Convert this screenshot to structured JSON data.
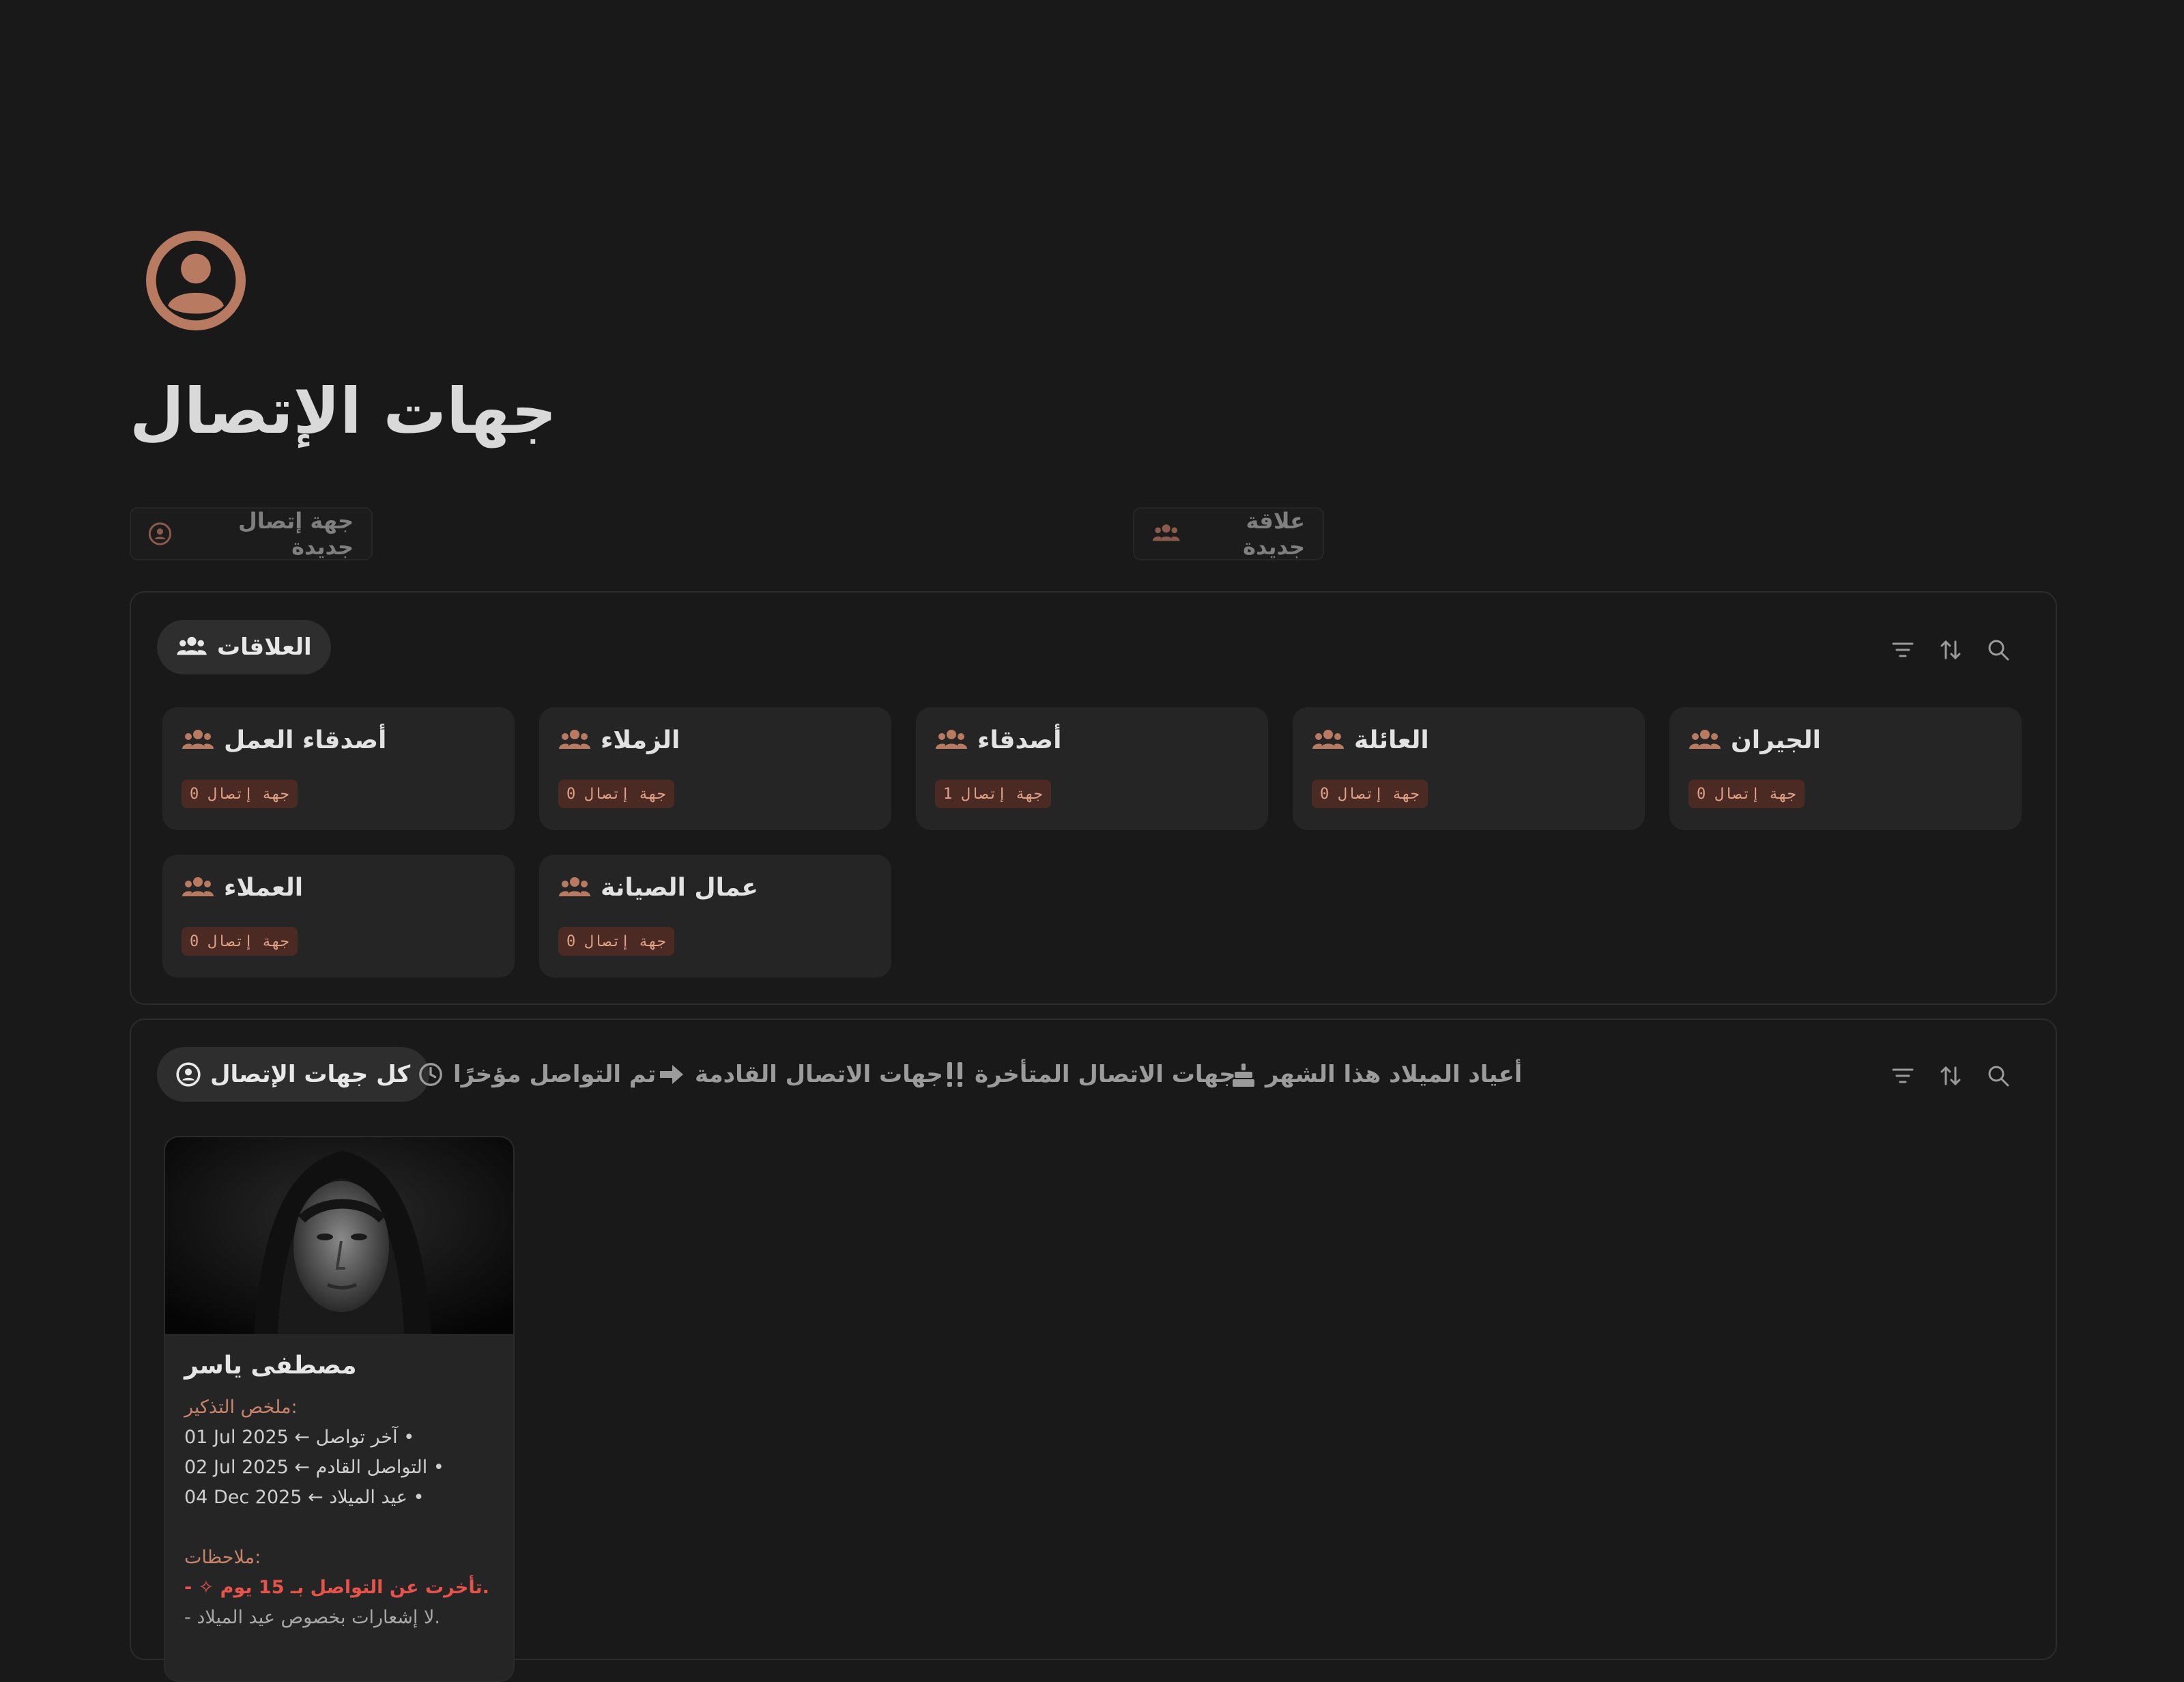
{
  "page": {
    "title": "جهات الإتصال",
    "icon": "contact-circle-icon"
  },
  "actions": {
    "new_contact": "جهة إتصال جديدة",
    "new_relation": "علاقة جديدة"
  },
  "relations_panel": {
    "tab_label": "العلاقات",
    "cards": [
      {
        "name": "الجيران",
        "count": "جهة إتصال 0"
      },
      {
        "name": "العائلة",
        "count": "جهة إتصال 0"
      },
      {
        "name": "أصدقاء",
        "count": "جهة إتصال 1"
      },
      {
        "name": "الزملاء",
        "count": "جهة إتصال 0"
      },
      {
        "name": "أصدقاء العمل",
        "count": "جهة إتصال 0"
      },
      {
        "name": "عمال الصيانة",
        "count": "جهة إتصال 0"
      },
      {
        "name": "العملاء",
        "count": "جهة إتصال 0"
      }
    ]
  },
  "contacts_panel": {
    "tabs": [
      {
        "label": "كل جهات الإتصال",
        "icon": "contact-circle-icon",
        "active": true
      },
      {
        "label": "تم التواصل مؤخرًا",
        "icon": "clock-icon"
      },
      {
        "label": "جهات الاتصال القادمة",
        "icon": "arrow-right-icon"
      },
      {
        "label": "جهات الاتصال المتأخرة",
        "icon": "double-exclamation-icon"
      },
      {
        "label": "أعياد الميلاد هذا الشهر",
        "icon": "cake-icon"
      }
    ],
    "card": {
      "name": "مصطفى ياسر",
      "reminder_heading": "ملخص التذكير:",
      "last_contact": "01 Jul 2025 ← آخر تواصل •",
      "next_contact": "02 Jul 2025 ← التواصل القادم •",
      "birthday": "04 Dec 2025 ← عيد الميلاد •",
      "notes_heading": "ملاحظات:",
      "note_overdue": "- ✧ تأخرت عن التواصل بـ 15 يوم.",
      "note_birthday": "- لا إشعارات بخصوص عيد الميلاد."
    }
  },
  "colors": {
    "accent": "#b97a62",
    "background": "#191919",
    "card": "#252525",
    "badge_bg": "#4a2a22",
    "overdue": "#e5534b"
  }
}
